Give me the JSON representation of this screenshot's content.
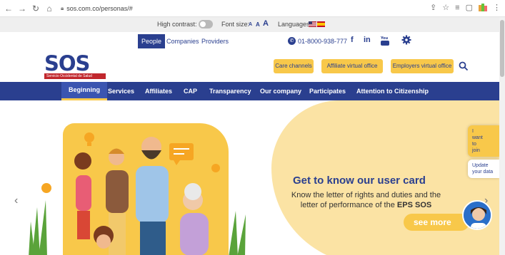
{
  "browser": {
    "url": "sos.com.co/personas/#"
  },
  "accessibility": {
    "high_contrast_label": "High contrast:",
    "font_size_label": "Font size:",
    "font_small": "A",
    "font_medium": "A",
    "font_large": "A",
    "languages_label": "Languages:"
  },
  "segments": [
    {
      "label": "People"
    },
    {
      "label": "Companies"
    },
    {
      "label": "Providers"
    }
  ],
  "contact": {
    "phone": "01-8000-938-777"
  },
  "social": [
    "f",
    "in"
  ],
  "brand": {
    "logo_text": "SOS",
    "tagline": "Servicio Occidental de Salud",
    "primary_color": "#2a3f8f",
    "accent_color": "#f8c84a",
    "red_color": "#c1272d"
  },
  "header_buttons": [
    {
      "label": "Care channels"
    },
    {
      "label": "Affiliate virtual office"
    },
    {
      "label": "Employers virtual office"
    }
  ],
  "main_nav": [
    {
      "label": "Beginning"
    },
    {
      "label": "Services"
    },
    {
      "label": "Affiliates"
    },
    {
      "label": "CAP"
    },
    {
      "label": "Transparency"
    },
    {
      "label": "Our company"
    },
    {
      "label": "Participates"
    },
    {
      "label": "Attention to Citizenship"
    }
  ],
  "hero": {
    "title": "Get to know our user card",
    "body_line1": "Know the letter of rights and duties and the",
    "body_line2_prefix": "letter of performance of the ",
    "body_line2_bold": "EPS SOS",
    "cta": "see more"
  },
  "side": {
    "join_line1": "I",
    "join_line2": "want",
    "join_line3": "to",
    "join_line4": "join",
    "update_line1": "Update",
    "update_line2": "your data"
  }
}
